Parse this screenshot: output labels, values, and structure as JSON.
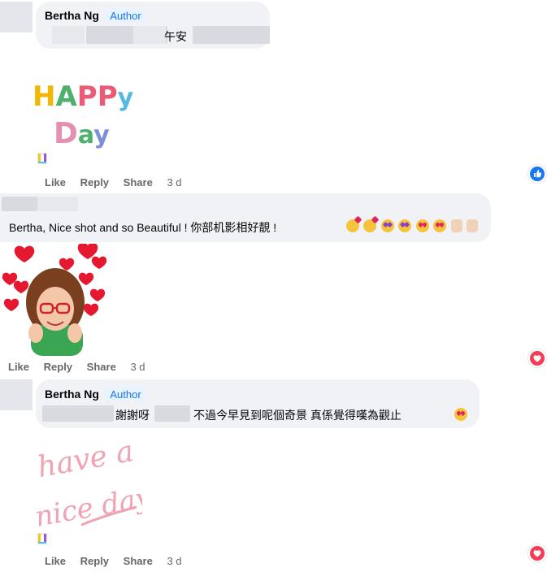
{
  "comments": [
    {
      "author": "Bertha Ng",
      "badge": "Author",
      "text_visible": "午安",
      "sticker_lines": [
        "HAPPy",
        "Day"
      ],
      "actions": {
        "like": "Like",
        "reply": "Reply",
        "share": "Share",
        "time": "3 d"
      },
      "reaction": "like"
    },
    {
      "author": "",
      "text": "Bertha, Nice shot and so Beautiful ! 你部机影相好靚 !",
      "emoji_seq": [
        "love-face",
        "love-face",
        "star-eyes",
        "star-eyes",
        "heart-eyes",
        "heart-eyes",
        "thumbs-up",
        "thumbs-up"
      ],
      "actions": {
        "like": "Like",
        "reply": "Reply",
        "share": "Share",
        "time": "3 d"
      },
      "reaction": "love"
    },
    {
      "author": "Bertha Ng",
      "badge": "Author",
      "text_part1": "謝謝呀",
      "text_part2": "不過今早見到呢個奇景 真係覺得嘆為觀止",
      "sticker_lines": [
        "have a",
        "nice day"
      ],
      "actions": {
        "like": "Like",
        "reply": "Reply",
        "share": "Share",
        "time": "3 d"
      },
      "reaction": "love"
    }
  ],
  "colors": {
    "bubble": "#f0f2f5",
    "badge_bg": "#e7f3ff",
    "badge_text": "#1b74e4",
    "action_text": "#65676b",
    "like_blue": "#1877f2",
    "love_red": "#f33e58"
  }
}
